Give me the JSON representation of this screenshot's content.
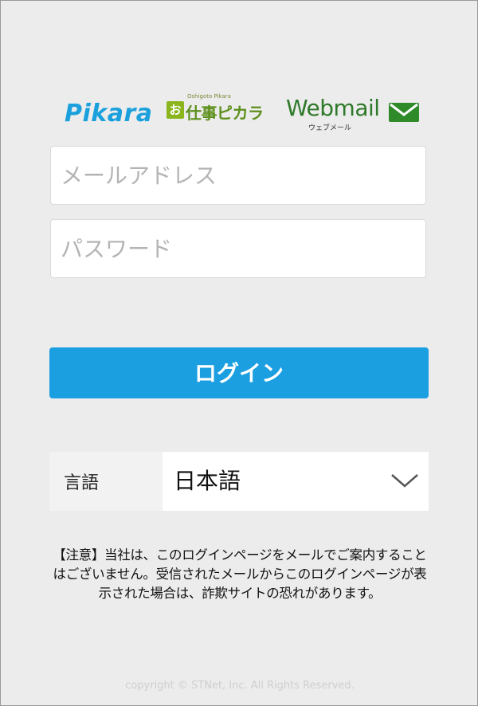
{
  "logos": {
    "pikara": "Pikara",
    "oshigoto_badge": "お",
    "oshigoto_tag": "Oshigoto Pikara",
    "oshigoto_text": "仕事ピカラ",
    "webmail": "Webmail",
    "webmail_sub": "ウェブメール",
    "webmail_icon": "envelope-icon"
  },
  "form": {
    "email_placeholder": "メールアドレス",
    "email_value": "",
    "password_placeholder": "パスワード",
    "password_value": "",
    "login_label": "ログイン"
  },
  "language": {
    "label": "言語",
    "selected": "日本語",
    "icon": "chevron-down-icon"
  },
  "notice": "【注意】当社は、このログインページをメールでご案内することはございません。受信されたメールからこのログインページが表示された場合は、詐欺サイトの恐れがあります。",
  "footer": {
    "copyright": "copyright © STNet, Inc. All Rights Reserved."
  },
  "colors": {
    "background": "#ececec",
    "primary_button": "#1b9fe0",
    "pikara_blue": "#1aa0dc",
    "oshigoto_green": "#5c8f1a",
    "webmail_green": "#2f7a2a"
  }
}
